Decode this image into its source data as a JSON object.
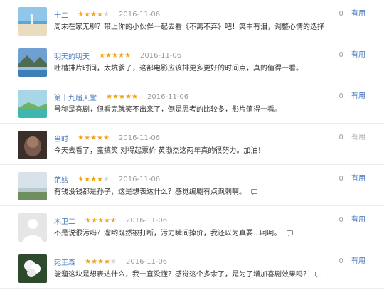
{
  "comments": [
    {
      "name": "十二",
      "stars": 4,
      "date": "2016-11-06",
      "text": "周末在家无聊？带上你的小伙伴一起去看《不离不弃》吧！笑中有泪，调整心情的选择",
      "useful_count": "0",
      "useful_label": "有用",
      "avatar": "beach",
      "has_reply_icon": false
    },
    {
      "name": "明天的明天",
      "stars": 5,
      "date": "2016-11-06",
      "text": "吐槽排片时间，太坑爹了，这部电影应该排更多更好的时间点，真的值得一看。",
      "useful_count": "0",
      "useful_label": "有用",
      "avatar": "lake",
      "has_reply_icon": false
    },
    {
      "name": "第十九届天堂",
      "stars": 5,
      "date": "2016-11-06",
      "text": "号称是喜剧，但看完就笑不出来了，倒是思考的比较多，影片值得一看。",
      "useful_count": "0",
      "useful_label": "有用",
      "avatar": "sea",
      "has_reply_icon": false
    },
    {
      "name": "当时",
      "stars": 5,
      "date": "2016-11-06",
      "text": "今天去看了，蛮搞笑 对得起票价 黄渤杰这两年真的很努力。加油！",
      "useful_count": "0",
      "useful_label": "有用",
      "avatar": "portrait",
      "has_reply_icon": false,
      "dim": true
    },
    {
      "name": "范姑",
      "stars": 4,
      "date": "2016-11-06",
      "text": "有钱没钱都是孙子，这是想表达什么？感觉编剧有点讽刺啊。",
      "useful_count": "0",
      "useful_label": "有用",
      "avatar": "sky",
      "has_reply_icon": true
    },
    {
      "name": "木卫二",
      "stars": 5,
      "date": "2016-11-06",
      "text": "不是说很污吗？溜哟既然被打断，污力瞬间掉价，我还以为真要...呵呵。",
      "useful_count": "0",
      "useful_label": "有用",
      "avatar": "blank",
      "has_reply_icon": true
    },
    {
      "name": "宛王森",
      "stars": 4,
      "date": "2016-11-06",
      "text": "能溜这块是想表达什么，我一直没懂？感觉这个多余了，是为了增加喜剧效果吗？",
      "useful_count": "0",
      "useful_label": "有用",
      "avatar": "flower",
      "has_reply_icon": true
    }
  ],
  "colors": {
    "star_on": "#f2a31b",
    "star_off": "#d4d4d4",
    "name": "#4a7bbf",
    "date": "#9a9a9a"
  }
}
